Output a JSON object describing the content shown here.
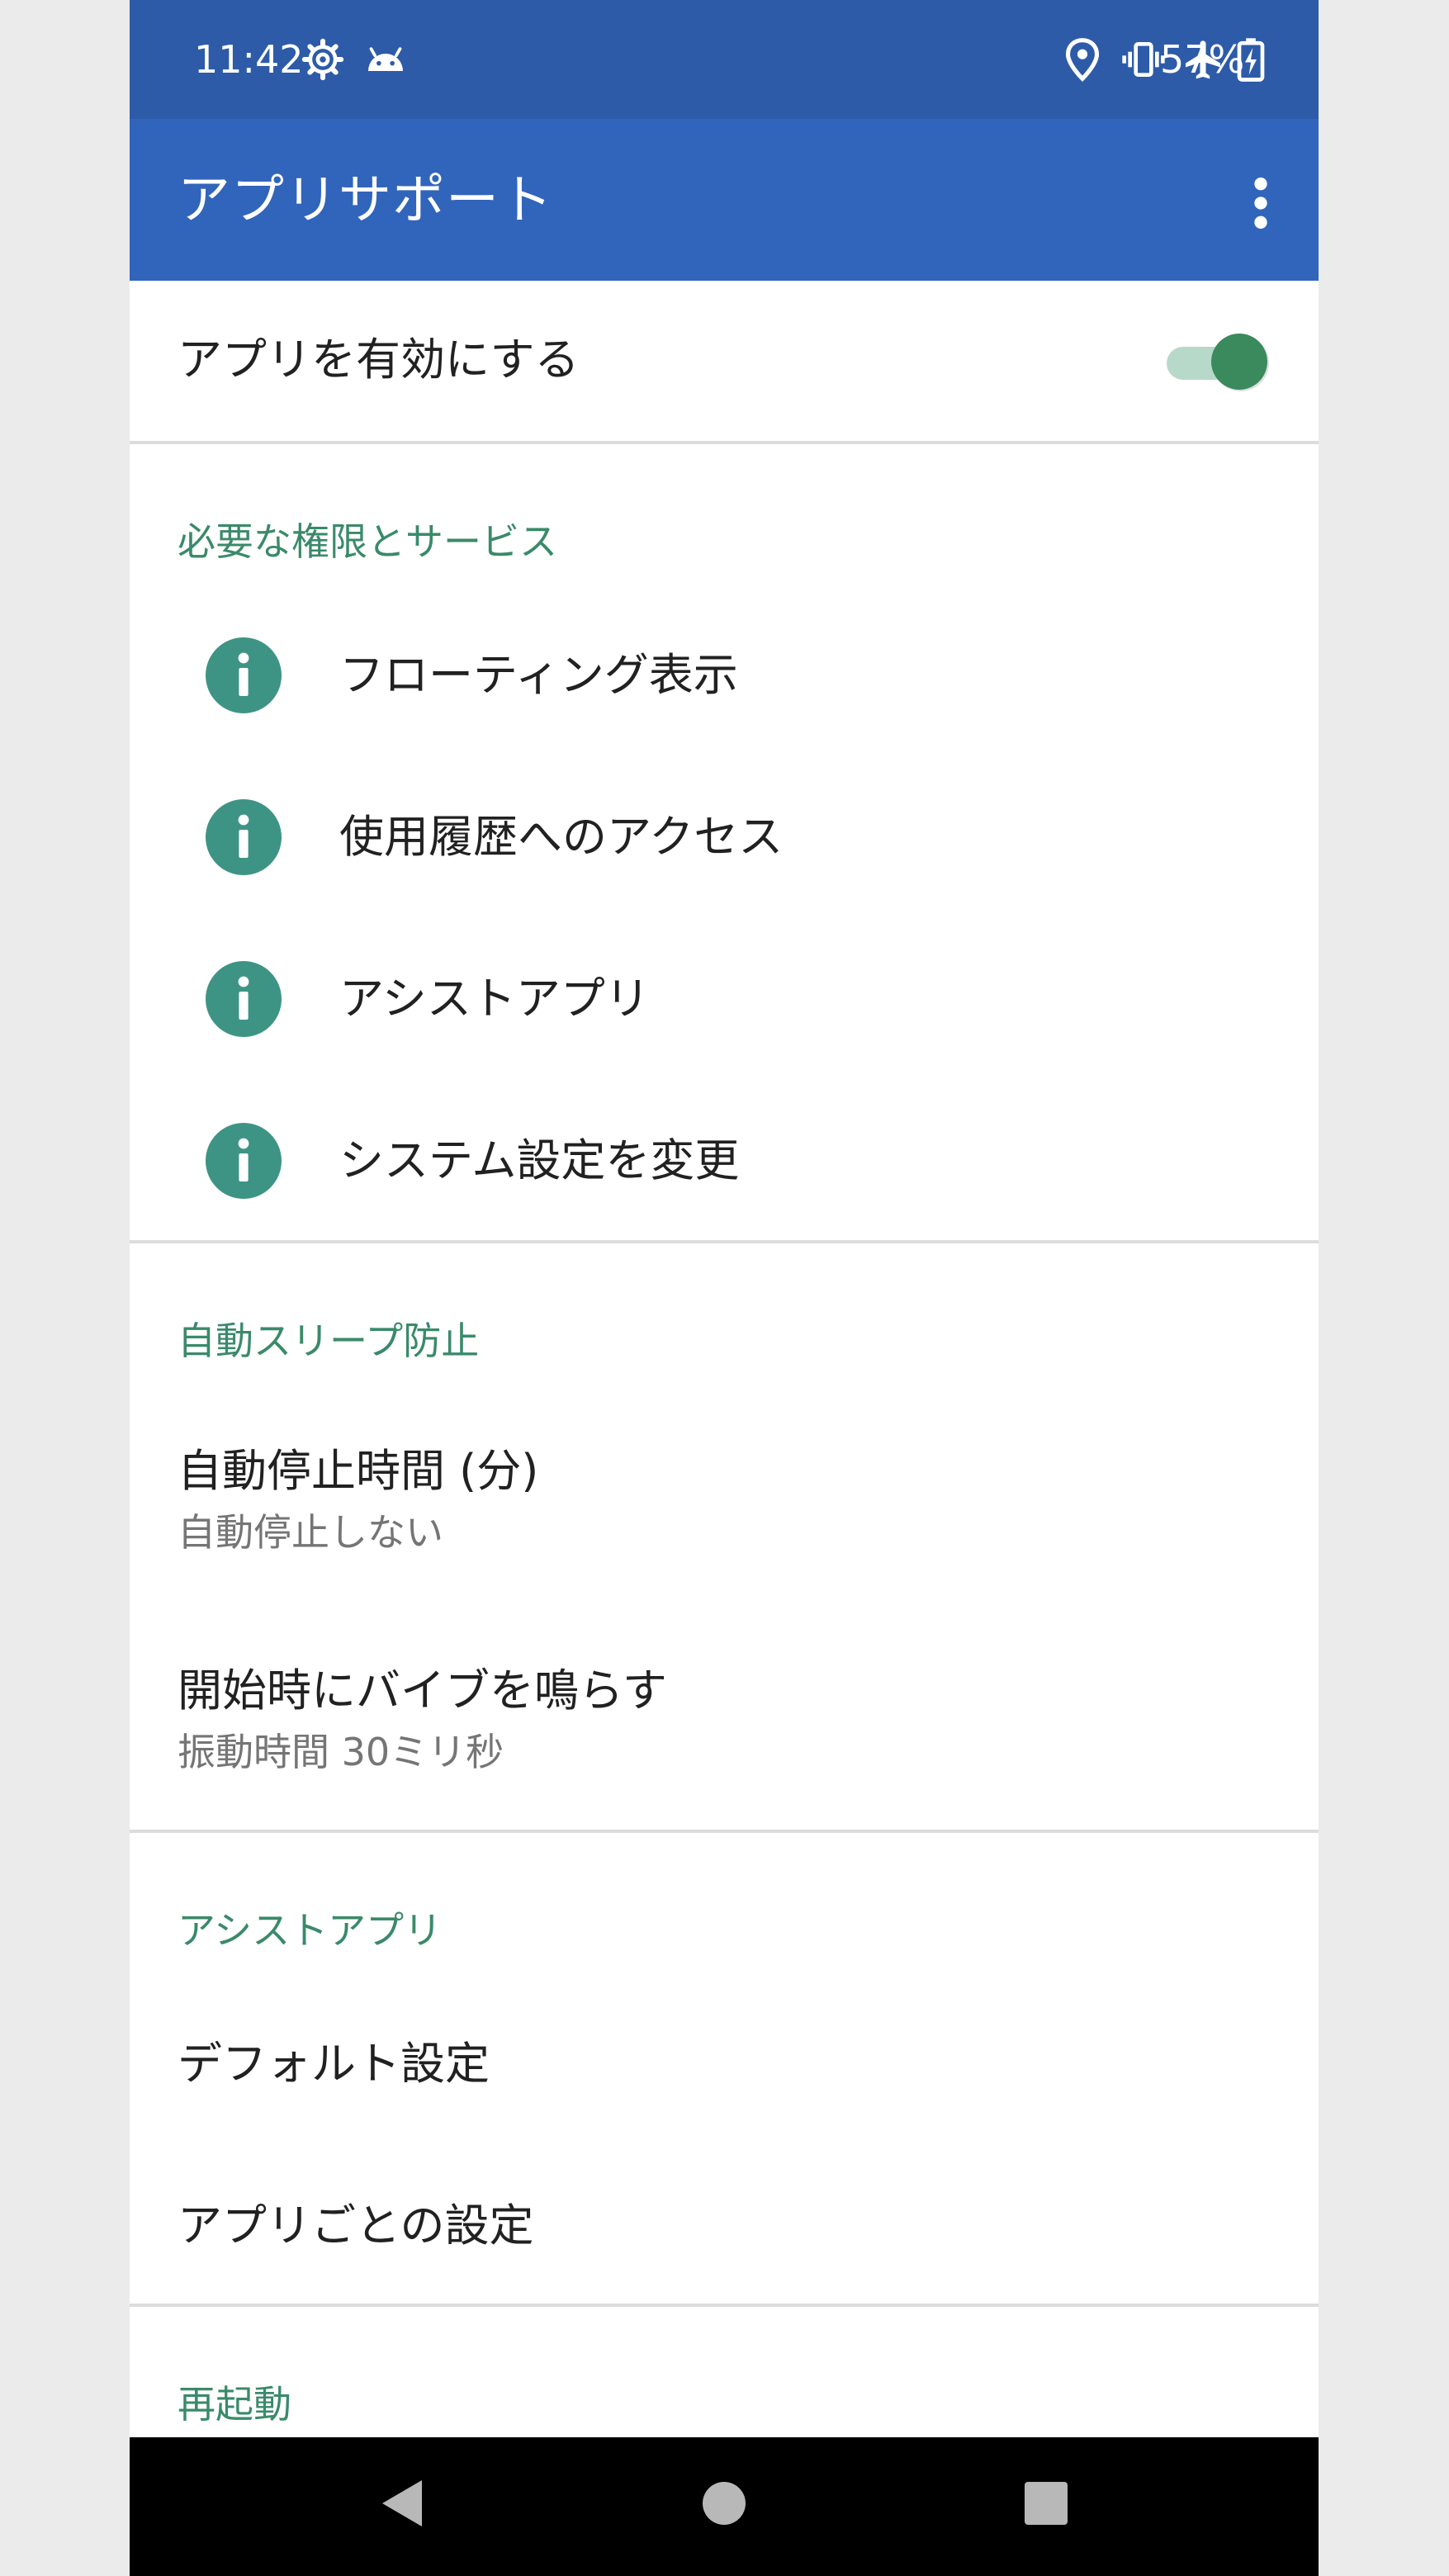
{
  "status_bar": {
    "time": "11:42",
    "battery_percent": "57%",
    "icons": [
      "settings-gear-icon",
      "android-icon",
      "location-icon",
      "vibrate-icon",
      "airplane-mode-icon",
      "battery-charging-icon"
    ]
  },
  "app_bar": {
    "title": "アプリサポート",
    "menu_icon": "more-vert-icon"
  },
  "enable_row": {
    "label": "アプリを有効にする",
    "toggle_on": true
  },
  "permissions": {
    "header": "必要な権限とサービス",
    "items": [
      {
        "label": "フローティング表示",
        "icon": "info-icon"
      },
      {
        "label": "使用履歴へのアクセス",
        "icon": "info-icon"
      },
      {
        "label": "アシストアプリ",
        "icon": "info-icon"
      },
      {
        "label": "システム設定を変更",
        "icon": "info-icon"
      }
    ]
  },
  "sleep": {
    "header": "自動スリープ防止",
    "auto_stop": {
      "title": "自動停止時間 (分)",
      "summary": "自動停止しない"
    },
    "vibrate": {
      "title": "開始時にバイブを鳴らす",
      "summary": "振動時間 30ミリ秒"
    }
  },
  "assist": {
    "header": "アシストアプリ",
    "default": "デフォルト設定",
    "per_app": "アプリごとの設定"
  },
  "restart": {
    "header": "再起動"
  },
  "colors": {
    "status_bar": "#2d5ba8",
    "app_bar": "#3165bb",
    "accent_green": "#3a8a6a",
    "info_icon": "#3e9484"
  },
  "nav_bar": {
    "icons": [
      "back-icon",
      "home-icon",
      "recents-icon"
    ]
  }
}
